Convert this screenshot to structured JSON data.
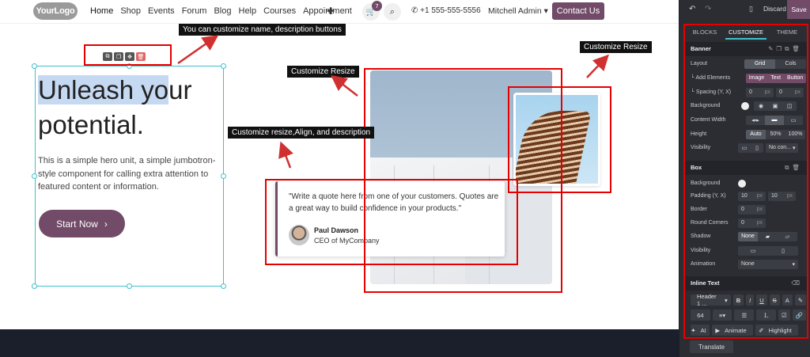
{
  "nav": {
    "logo": "YourLogo",
    "links": [
      "Home",
      "Shop",
      "Events",
      "Forum",
      "Blog",
      "Help",
      "Courses",
      "Appointment"
    ],
    "cart_count": "7",
    "phone": "+1 555-555-5556",
    "user": "Mitchell Admin",
    "contact_label": "Contact Us"
  },
  "hero": {
    "title_highlight": "Unleash yo",
    "title_rest": "ur",
    "title_line2": "potential.",
    "body": "This is a simple hero unit, a simple jumbotron-style component for calling extra attention to featured content or information.",
    "cta_label": "Start Now",
    "cta_chevron": "›"
  },
  "quote": {
    "text": "\"Write a quote here from one of your customers. Quotes are a great way to build confidence in your products.\"",
    "author": "Paul Dawson",
    "role": "CEO of MyCompany"
  },
  "annotations": {
    "buttons": "You can customize name, description buttons",
    "resize_left": "Customize Resize",
    "resize_right": "Customize Resize",
    "resize_align": "Customize resize,Align, and  description"
  },
  "editor": {
    "discard": "Discard",
    "save": "Save",
    "tabs": [
      "BLOCKS",
      "CUSTOMIZE",
      "THEME"
    ],
    "active_tab": "CUSTOMIZE",
    "banner": {
      "title": "Banner",
      "layout_label": "Layout",
      "layout_opts": [
        "Grid",
        "Cols"
      ],
      "add_label": "└ Add Elements",
      "add_opts": [
        "Image",
        "Text",
        "Button"
      ],
      "spacing_label": "└ Spacing (Y, X)",
      "spacing_y": "0",
      "spacing_x": "0",
      "unit": "px",
      "background_label": "Background",
      "content_width_label": "Content Width",
      "height_label": "Height",
      "height_opts": [
        "Auto",
        "50%",
        "100%"
      ],
      "visibility_label": "Visibility",
      "visibility_value": "No con..."
    },
    "box": {
      "title": "Box",
      "background_label": "Background",
      "padding_label": "Padding (Y, X)",
      "padding_y": "10",
      "padding_x": "10",
      "border_label": "Border",
      "border_value": "0",
      "corners_label": "Round Corners",
      "corners_value": "0",
      "shadow_label": "Shadow",
      "shadow_value": "None",
      "visibility_label": "Visibility",
      "animation_label": "Animation",
      "animation_value": "None"
    },
    "inline": {
      "title": "Inline Text",
      "style_value": "Header 1 ...",
      "size_value": "64",
      "ai": "AI",
      "animate": "Animate",
      "highlight": "Highlight"
    },
    "translate": "Translate"
  }
}
